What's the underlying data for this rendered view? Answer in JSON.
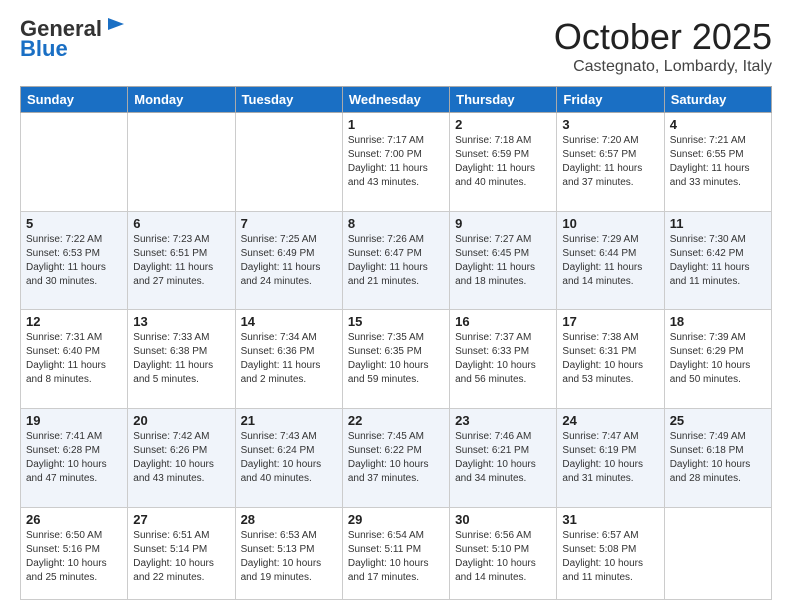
{
  "header": {
    "logo_general": "General",
    "logo_blue": "Blue",
    "month": "October 2025",
    "location": "Castegnato, Lombardy, Italy"
  },
  "weekdays": [
    "Sunday",
    "Monday",
    "Tuesday",
    "Wednesday",
    "Thursday",
    "Friday",
    "Saturday"
  ],
  "weeks": [
    [
      {
        "day": "",
        "info": ""
      },
      {
        "day": "",
        "info": ""
      },
      {
        "day": "",
        "info": ""
      },
      {
        "day": "1",
        "info": "Sunrise: 7:17 AM\nSunset: 7:00 PM\nDaylight: 11 hours\nand 43 minutes."
      },
      {
        "day": "2",
        "info": "Sunrise: 7:18 AM\nSunset: 6:59 PM\nDaylight: 11 hours\nand 40 minutes."
      },
      {
        "day": "3",
        "info": "Sunrise: 7:20 AM\nSunset: 6:57 PM\nDaylight: 11 hours\nand 37 minutes."
      },
      {
        "day": "4",
        "info": "Sunrise: 7:21 AM\nSunset: 6:55 PM\nDaylight: 11 hours\nand 33 minutes."
      }
    ],
    [
      {
        "day": "5",
        "info": "Sunrise: 7:22 AM\nSunset: 6:53 PM\nDaylight: 11 hours\nand 30 minutes."
      },
      {
        "day": "6",
        "info": "Sunrise: 7:23 AM\nSunset: 6:51 PM\nDaylight: 11 hours\nand 27 minutes."
      },
      {
        "day": "7",
        "info": "Sunrise: 7:25 AM\nSunset: 6:49 PM\nDaylight: 11 hours\nand 24 minutes."
      },
      {
        "day": "8",
        "info": "Sunrise: 7:26 AM\nSunset: 6:47 PM\nDaylight: 11 hours\nand 21 minutes."
      },
      {
        "day": "9",
        "info": "Sunrise: 7:27 AM\nSunset: 6:45 PM\nDaylight: 11 hours\nand 18 minutes."
      },
      {
        "day": "10",
        "info": "Sunrise: 7:29 AM\nSunset: 6:44 PM\nDaylight: 11 hours\nand 14 minutes."
      },
      {
        "day": "11",
        "info": "Sunrise: 7:30 AM\nSunset: 6:42 PM\nDaylight: 11 hours\nand 11 minutes."
      }
    ],
    [
      {
        "day": "12",
        "info": "Sunrise: 7:31 AM\nSunset: 6:40 PM\nDaylight: 11 hours\nand 8 minutes."
      },
      {
        "day": "13",
        "info": "Sunrise: 7:33 AM\nSunset: 6:38 PM\nDaylight: 11 hours\nand 5 minutes."
      },
      {
        "day": "14",
        "info": "Sunrise: 7:34 AM\nSunset: 6:36 PM\nDaylight: 11 hours\nand 2 minutes."
      },
      {
        "day": "15",
        "info": "Sunrise: 7:35 AM\nSunset: 6:35 PM\nDaylight: 10 hours\nand 59 minutes."
      },
      {
        "day": "16",
        "info": "Sunrise: 7:37 AM\nSunset: 6:33 PM\nDaylight: 10 hours\nand 56 minutes."
      },
      {
        "day": "17",
        "info": "Sunrise: 7:38 AM\nSunset: 6:31 PM\nDaylight: 10 hours\nand 53 minutes."
      },
      {
        "day": "18",
        "info": "Sunrise: 7:39 AM\nSunset: 6:29 PM\nDaylight: 10 hours\nand 50 minutes."
      }
    ],
    [
      {
        "day": "19",
        "info": "Sunrise: 7:41 AM\nSunset: 6:28 PM\nDaylight: 10 hours\nand 47 minutes."
      },
      {
        "day": "20",
        "info": "Sunrise: 7:42 AM\nSunset: 6:26 PM\nDaylight: 10 hours\nand 43 minutes."
      },
      {
        "day": "21",
        "info": "Sunrise: 7:43 AM\nSunset: 6:24 PM\nDaylight: 10 hours\nand 40 minutes."
      },
      {
        "day": "22",
        "info": "Sunrise: 7:45 AM\nSunset: 6:22 PM\nDaylight: 10 hours\nand 37 minutes."
      },
      {
        "day": "23",
        "info": "Sunrise: 7:46 AM\nSunset: 6:21 PM\nDaylight: 10 hours\nand 34 minutes."
      },
      {
        "day": "24",
        "info": "Sunrise: 7:47 AM\nSunset: 6:19 PM\nDaylight: 10 hours\nand 31 minutes."
      },
      {
        "day": "25",
        "info": "Sunrise: 7:49 AM\nSunset: 6:18 PM\nDaylight: 10 hours\nand 28 minutes."
      }
    ],
    [
      {
        "day": "26",
        "info": "Sunrise: 6:50 AM\nSunset: 5:16 PM\nDaylight: 10 hours\nand 25 minutes."
      },
      {
        "day": "27",
        "info": "Sunrise: 6:51 AM\nSunset: 5:14 PM\nDaylight: 10 hours\nand 22 minutes."
      },
      {
        "day": "28",
        "info": "Sunrise: 6:53 AM\nSunset: 5:13 PM\nDaylight: 10 hours\nand 19 minutes."
      },
      {
        "day": "29",
        "info": "Sunrise: 6:54 AM\nSunset: 5:11 PM\nDaylight: 10 hours\nand 17 minutes."
      },
      {
        "day": "30",
        "info": "Sunrise: 6:56 AM\nSunset: 5:10 PM\nDaylight: 10 hours\nand 14 minutes."
      },
      {
        "day": "31",
        "info": "Sunrise: 6:57 AM\nSunset: 5:08 PM\nDaylight: 10 hours\nand 11 minutes."
      },
      {
        "day": "",
        "info": ""
      }
    ]
  ]
}
